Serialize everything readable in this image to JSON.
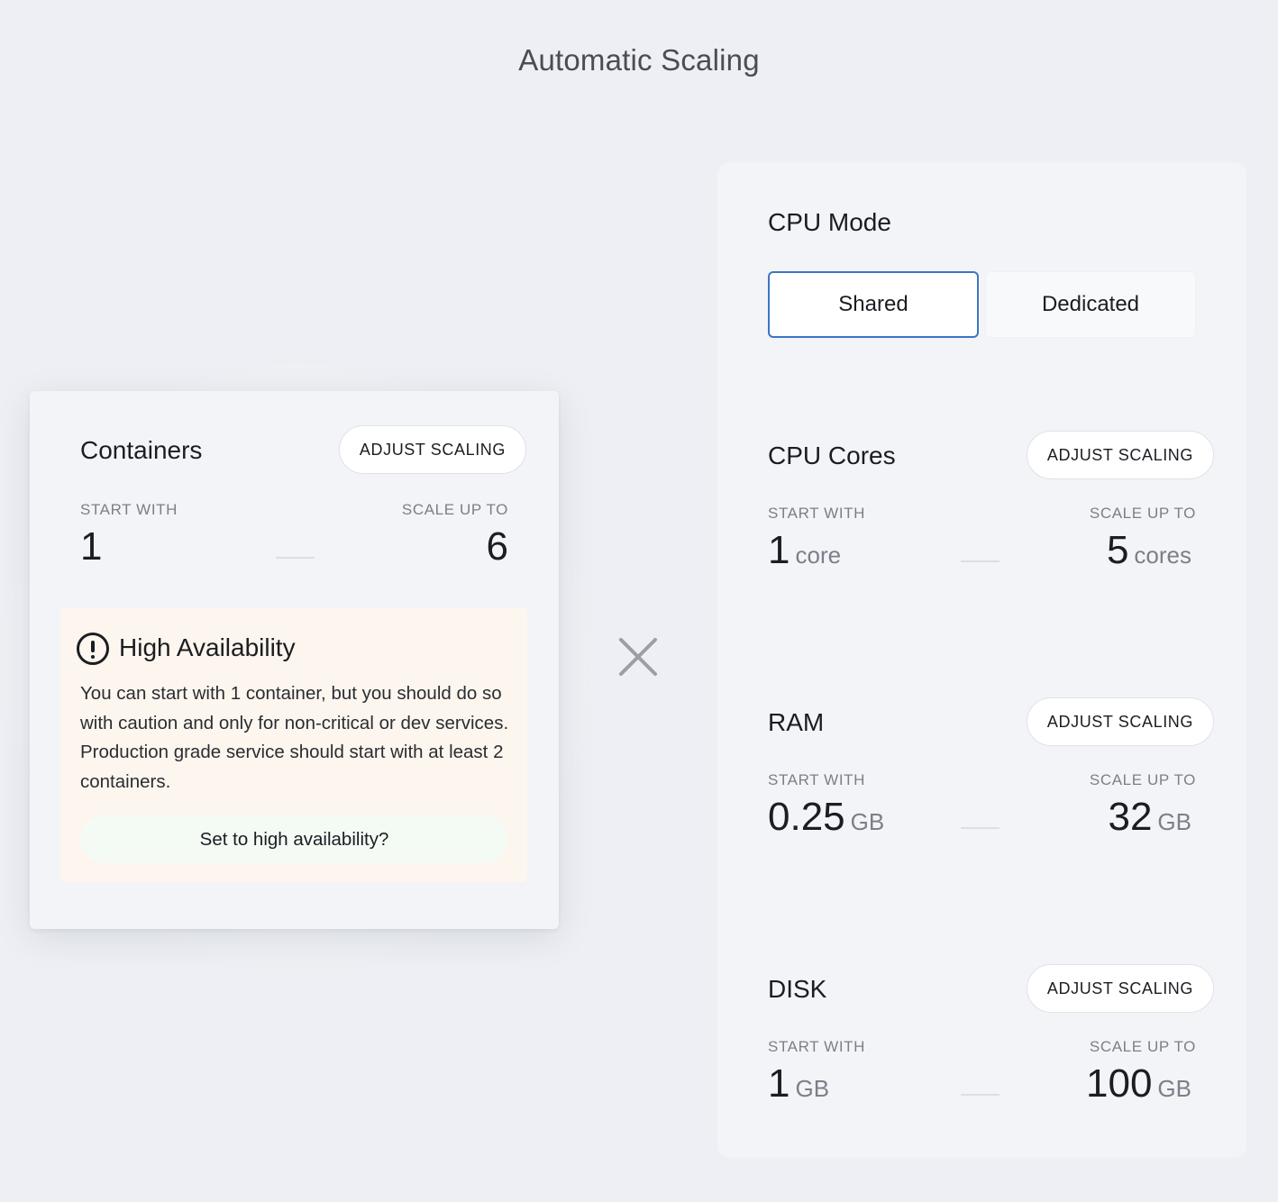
{
  "page": {
    "title": "Automatic Scaling"
  },
  "containers": {
    "title": "Containers",
    "adjust_label": "ADJUST SCALING",
    "start_label": "START WITH",
    "scale_label": "SCALE UP TO",
    "start_value": "1",
    "scale_value": "6",
    "high_availability": {
      "icon": "exclamation-circle-icon",
      "title": "High Availability",
      "text": "You can start with 1 container, but you should do so with caution and only for non-critical or dev services. Production grade service should start with at least 2 containers.",
      "button_label": "Set to high availability?"
    }
  },
  "multiply_icon": "multiply-icon",
  "cpu_mode": {
    "title": "CPU Mode",
    "options": [
      "Shared",
      "Dedicated"
    ],
    "selected": "Shared",
    "selected_border_color": "#3b76c4"
  },
  "cpu_cores": {
    "title": "CPU Cores",
    "adjust_label": "ADJUST SCALING",
    "start_label": "START WITH",
    "scale_label": "SCALE UP TO",
    "start_value": "1",
    "start_unit": "core",
    "scale_value": "5",
    "scale_unit": "cores"
  },
  "ram": {
    "title": "RAM",
    "adjust_label": "ADJUST SCALING",
    "start_label": "START WITH",
    "scale_label": "SCALE UP TO",
    "start_value": "0.25",
    "start_unit": "GB",
    "scale_value": "32",
    "scale_unit": "GB"
  },
  "disk": {
    "title": "DISK",
    "adjust_label": "ADJUST SCALING",
    "start_label": "START WITH",
    "scale_label": "SCALE UP TO",
    "start_value": "1",
    "start_unit": "GB",
    "scale_value": "100",
    "scale_unit": "GB"
  }
}
